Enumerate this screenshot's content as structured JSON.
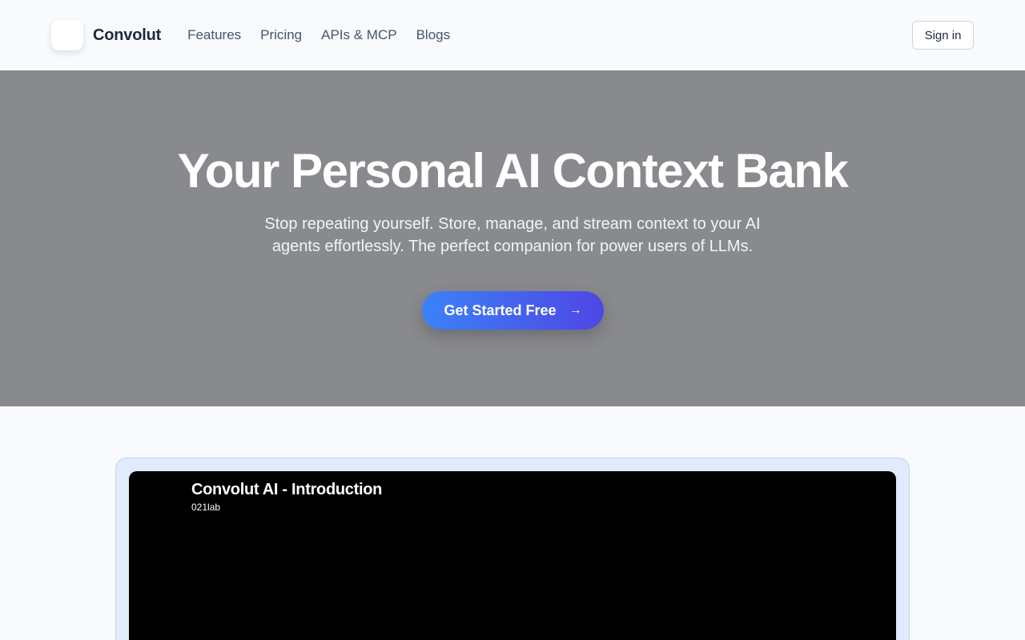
{
  "header": {
    "brand": "Convolut",
    "nav": [
      "Features",
      "Pricing",
      "APIs & MCP",
      "Blogs"
    ],
    "signin_label": "Sign in"
  },
  "hero": {
    "title": "Your Personal AI Context Bank",
    "subtitle_line1": "Stop repeating yourself. Store, manage, and stream context to your AI",
    "subtitle_line2": "agents effortlessly. The perfect companion for power users of LLMs.",
    "cta_label": "Get Started Free",
    "cta_icon": "arrow-right-icon",
    "background_color": "#898a8d"
  },
  "video": {
    "title": "Convolut AI - Introduction",
    "channel": "021lab"
  },
  "colors": {
    "accent_start": "#3b82f6",
    "accent_end": "#4f46e5",
    "text_dark": "#1e293b",
    "nav_text": "#475569"
  }
}
